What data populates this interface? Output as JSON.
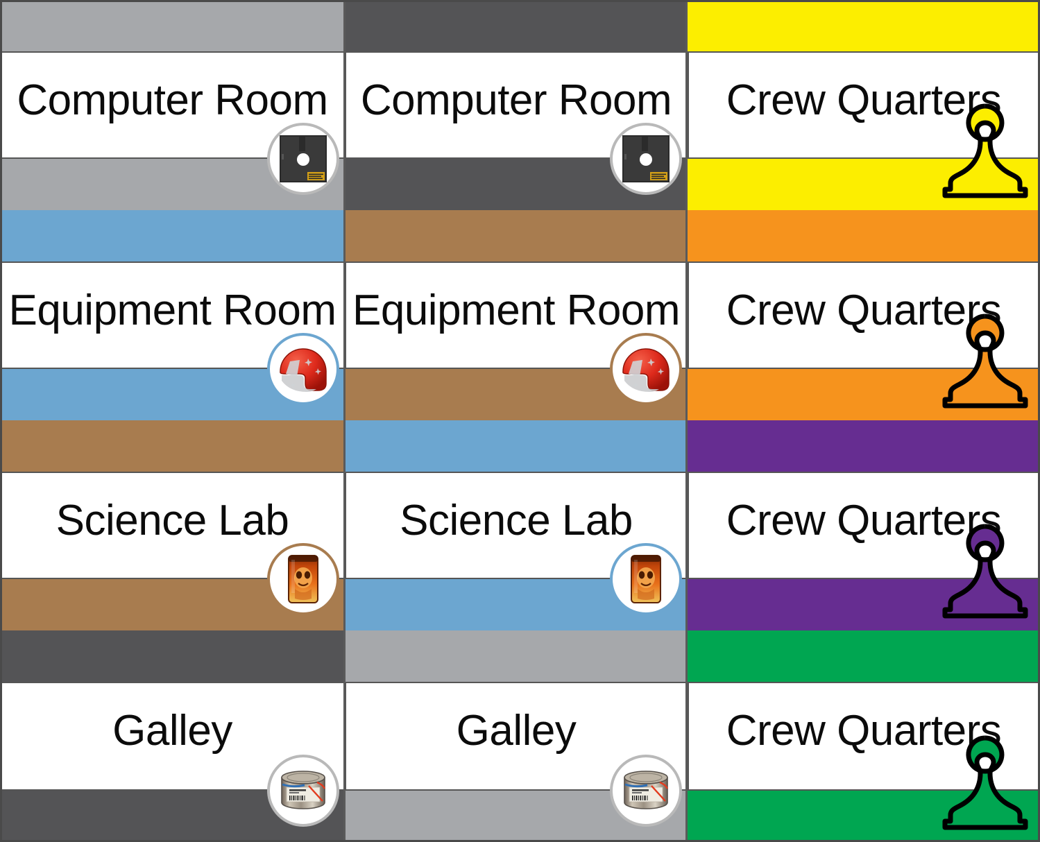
{
  "board": {
    "columns": 3,
    "rows": 4,
    "outline_color": "#4a4a4a"
  },
  "cells": [
    {
      "row": 0,
      "col": 0,
      "title": "Computer Room",
      "band_top_color": "#a6a8ab",
      "band_bottom_color": "#a6a8ab",
      "token": "floppy-disk-icon",
      "token_ring_color": "#b9b9b9",
      "piece": null
    },
    {
      "row": 0,
      "col": 1,
      "title": "Computer Room",
      "band_top_color": "#545456",
      "band_bottom_color": "#545456",
      "token": "floppy-disk-icon",
      "token_ring_color": "#b9b9b9",
      "piece": null
    },
    {
      "row": 0,
      "col": 2,
      "title": "Crew Quarters",
      "band_top_color": "#fcee00",
      "band_bottom_color": "#fcee00",
      "token": null,
      "token_ring_color": null,
      "piece": "pawn-token",
      "piece_color": "#fcee00"
    },
    {
      "row": 1,
      "col": 0,
      "title": "Equipment Room",
      "band_top_color": "#6ca6d0",
      "band_bottom_color": "#6ca6d0",
      "token": "helmet-icon",
      "token_ring_color": "#6ca6d0",
      "piece": null
    },
    {
      "row": 1,
      "col": 1,
      "title": "Equipment Room",
      "band_top_color": "#a87c4f",
      "band_bottom_color": "#a87c4f",
      "token": "helmet-icon",
      "token_ring_color": "#a87c4f",
      "piece": null
    },
    {
      "row": 1,
      "col": 2,
      "title": "Crew Quarters",
      "band_top_color": "#f6931d",
      "band_bottom_color": "#f6931d",
      "token": null,
      "token_ring_color": null,
      "piece": "pawn-token",
      "piece_color": "#f6931d"
    },
    {
      "row": 2,
      "col": 0,
      "title": "Science Lab",
      "band_top_color": "#a87c4f",
      "band_bottom_color": "#a87c4f",
      "token": "specimen-jar-icon",
      "token_ring_color": "#a87c4f",
      "piece": null
    },
    {
      "row": 2,
      "col": 1,
      "title": "Science Lab",
      "band_top_color": "#6ca6d0",
      "band_bottom_color": "#6ca6d0",
      "token": "specimen-jar-icon",
      "token_ring_color": "#6ca6d0",
      "piece": null
    },
    {
      "row": 2,
      "col": 2,
      "title": "Crew Quarters",
      "band_top_color": "#662d91",
      "band_bottom_color": "#662d91",
      "token": null,
      "token_ring_color": null,
      "piece": "pawn-token",
      "piece_color": "#662d91"
    },
    {
      "row": 3,
      "col": 0,
      "title": "Galley",
      "band_top_color": "#545456",
      "band_bottom_color": "#545456",
      "token": "food-can-icon",
      "token_ring_color": "#b9b9b9",
      "piece": null
    },
    {
      "row": 3,
      "col": 1,
      "title": "Galley",
      "band_top_color": "#a6a8ab",
      "band_bottom_color": "#a6a8ab",
      "token": "food-can-icon",
      "token_ring_color": "#b9b9b9",
      "piece": null
    },
    {
      "row": 3,
      "col": 2,
      "title": "Crew Quarters",
      "band_top_color": "#00a651",
      "band_bottom_color": "#00a651",
      "token": null,
      "token_ring_color": null,
      "piece": "pawn-token",
      "piece_color": "#00a651"
    }
  ],
  "palette": {
    "light_gray": "#a6a8ab",
    "dark_gray": "#545456",
    "yellow": "#fcee00",
    "blue": "#6ca6d0",
    "brown": "#a87c4f",
    "orange": "#f6931d",
    "purple": "#662d91",
    "green": "#00a651",
    "white": "#ffffff",
    "line": "#555555"
  },
  "icon_labels": {
    "floppy-disk-icon": "floppy disk",
    "helmet-icon": "red helmet",
    "specimen-jar-icon": "alien specimen jar",
    "food-can-icon": "food ration can",
    "pawn-token": "pawn game piece"
  }
}
